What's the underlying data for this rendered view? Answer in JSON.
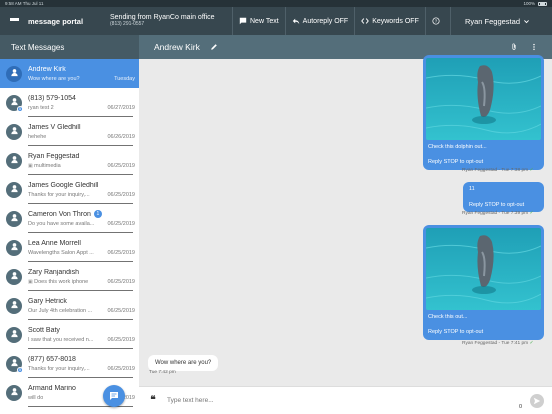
{
  "status_bar": {
    "time": "9:58 AM",
    "date": "Thu Jul 11",
    "battery": "100%"
  },
  "topbar": {
    "brand": "message portal",
    "sending_line1": "Sending from RyanCo main office",
    "sending_line2": "(813) 291-0557",
    "new_text": "New Text",
    "autoreply": "Autoreply OFF",
    "keywords": "Keywords OFF",
    "user": "Ryan Feggestad"
  },
  "sidebar": {
    "title": "Text Messages",
    "conversations": [
      {
        "name": "Andrew Kirk",
        "preview": "Wow where are you?",
        "date": "Tuesday",
        "active": true
      },
      {
        "name": "(813) 579-1054",
        "preview": "ryan test 2",
        "date": "06/27/2019",
        "badge": "5"
      },
      {
        "name": "James V Gledhill",
        "preview": "hehehe",
        "date": "06/26/2019"
      },
      {
        "name": "Ryan Feggestad",
        "preview": "multimedia",
        "date": "06/25/2019",
        "media": true
      },
      {
        "name": "James Google Gledhill",
        "preview": "Thanks for your inquiry,...",
        "date": "06/25/2019"
      },
      {
        "name": "Cameron Von Thron",
        "preview": "Do you have some availa...",
        "date": "06/25/2019",
        "unread": "1"
      },
      {
        "name": "Lea Anne Morrell",
        "preview": "Wavelengths Salon Appt ...",
        "date": "06/25/2019"
      },
      {
        "name": "Zary Ranjandish",
        "preview": "Does this work iphone",
        "date": "06/25/2019",
        "media": true
      },
      {
        "name": "Gary Hetrick",
        "preview": "Our July 4th celebration ...",
        "date": "06/25/2019"
      },
      {
        "name": "Scott Baty",
        "preview": "I saw that you received n...",
        "date": "06/25/2019"
      },
      {
        "name": "(877) 657-8018",
        "preview": "Thanks for your inquiry,...",
        "date": "06/25/2019",
        "badge": "5"
      },
      {
        "name": "Armand Marino",
        "preview": "will do",
        "date": "06/25/2019"
      }
    ]
  },
  "chat": {
    "contact": "Andrew Kirk",
    "messages": [
      {
        "caption": "Check this dolphin out...",
        "optout": "Reply STOP to opt-out",
        "meta": "Ryan Feggestad - Tue 7:38 pm"
      },
      {
        "text": "11",
        "optout": "Reply STOP to opt-out",
        "meta": "Ryan Feggestad - Tue 7:39 pm"
      },
      {
        "caption": "Check this out...",
        "optout": "Reply STOP to opt-out",
        "meta": "Ryan Feggestad - Tue 7:41 pm"
      }
    ],
    "incoming": {
      "text": "Wow where are you?",
      "meta": "Tue 7:42 pm"
    }
  },
  "composer": {
    "placeholder": "Type text here...",
    "count": "0"
  },
  "colors": {
    "accent": "#4a90e2",
    "topbar": "#37474f",
    "chat_header": "#546e7a"
  }
}
